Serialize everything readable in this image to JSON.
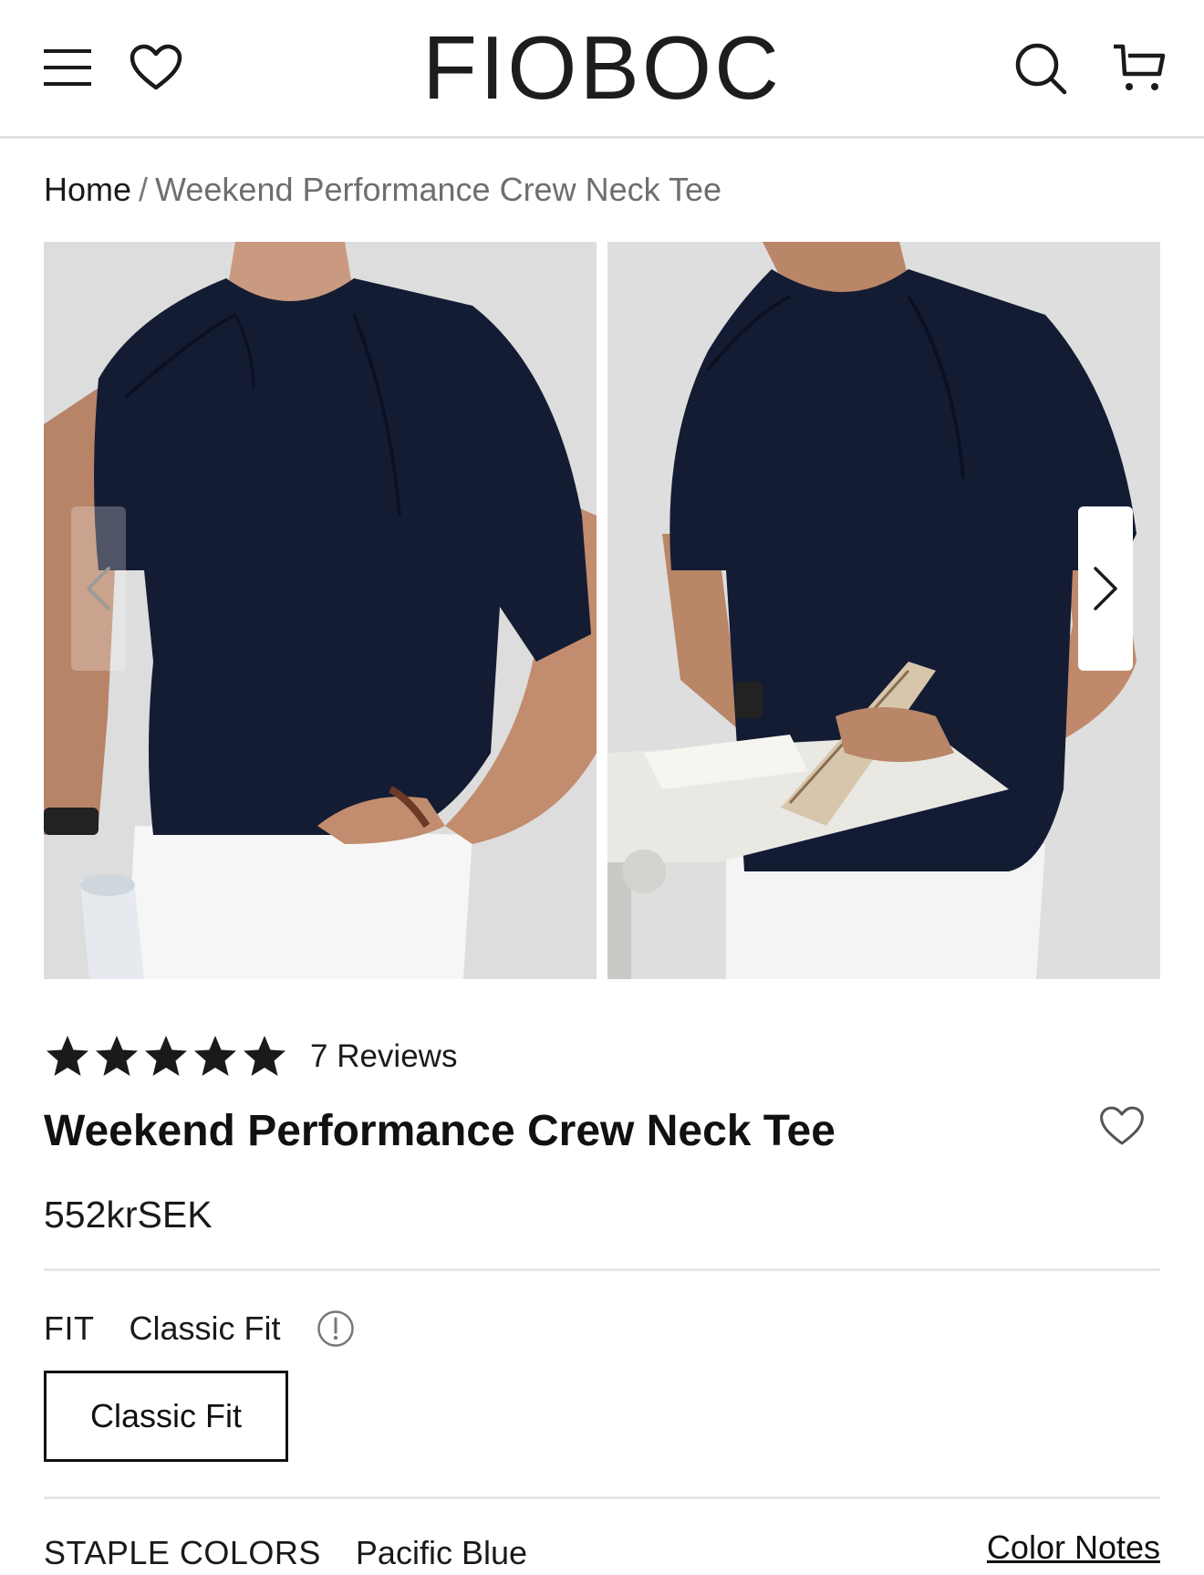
{
  "header": {
    "logo": "FIOBOC",
    "icons": [
      "hamburger-menu-icon",
      "heart-icon",
      "search-icon",
      "cart-icon"
    ]
  },
  "breadcrumb": {
    "home": "Home",
    "separator": "/",
    "current": "Weekend Performance Crew Neck Tee"
  },
  "gallery": {
    "images": [
      "Model wearing navy crew neck tee holding water bottle",
      "Model in navy crew neck tee reading notebook at desk"
    ]
  },
  "product": {
    "rating": 5,
    "reviews_label": "7 Reviews",
    "title": "Weekend Performance Crew Neck Tee",
    "price": "552krSEK"
  },
  "fit": {
    "label": "FIT",
    "selected": "Classic Fit",
    "option": "Classic Fit"
  },
  "colors": {
    "label": "STAPLE COLORS",
    "selected": "Pacific Blue",
    "notes_link": "Color Notes"
  },
  "theme": {
    "shirt": "#141c33",
    "background": "#dcdcdc",
    "text": "#1a1a1a"
  }
}
